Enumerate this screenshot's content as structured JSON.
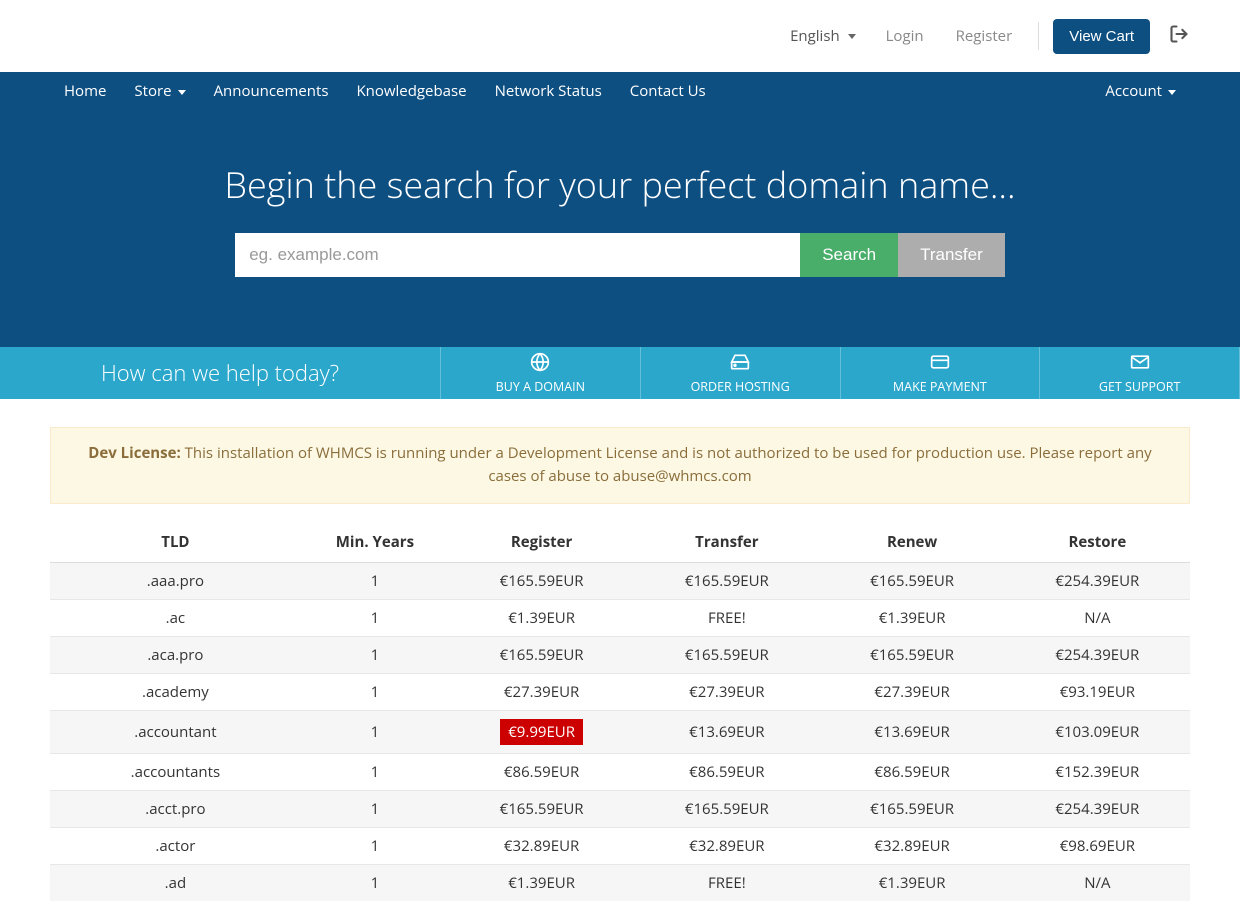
{
  "topbar": {
    "language": "English",
    "login": "Login",
    "register": "Register",
    "view_cart": "View Cart"
  },
  "nav": {
    "items": [
      "Home",
      "Store",
      "Announcements",
      "Knowledgebase",
      "Network Status",
      "Contact Us"
    ],
    "account": "Account"
  },
  "hero": {
    "title": "Begin the search for your perfect domain name...",
    "placeholder": "eg. example.com",
    "search": "Search",
    "transfer": "Transfer"
  },
  "help": {
    "text": "How can we help today?",
    "tiles": [
      {
        "label": "BUY A DOMAIN"
      },
      {
        "label": "ORDER HOSTING"
      },
      {
        "label": "MAKE PAYMENT"
      },
      {
        "label": "GET SUPPORT"
      }
    ]
  },
  "alert": {
    "strong": "Dev License:",
    "text": "This installation of WHMCS is running under a Development License and is not authorized to be used for production use. Please report any cases of abuse to abuse@whmcs.com"
  },
  "table": {
    "headers": [
      "TLD",
      "Min. Years",
      "Register",
      "Transfer",
      "Renew",
      "Restore"
    ],
    "rows": [
      {
        "tld": ".aaa.pro",
        "min": "1",
        "register": "€165.59EUR",
        "transfer": "€165.59EUR",
        "renew": "€165.59EUR",
        "restore": "€254.39EUR",
        "sale": false
      },
      {
        "tld": ".ac",
        "min": "1",
        "register": "€1.39EUR",
        "transfer": "FREE!",
        "renew": "€1.39EUR",
        "restore": "N/A",
        "sale": false
      },
      {
        "tld": ".aca.pro",
        "min": "1",
        "register": "€165.59EUR",
        "transfer": "€165.59EUR",
        "renew": "€165.59EUR",
        "restore": "€254.39EUR",
        "sale": false
      },
      {
        "tld": ".academy",
        "min": "1",
        "register": "€27.39EUR",
        "transfer": "€27.39EUR",
        "renew": "€27.39EUR",
        "restore": "€93.19EUR",
        "sale": false
      },
      {
        "tld": ".accountant",
        "min": "1",
        "register": "€9.99EUR",
        "transfer": "€13.69EUR",
        "renew": "€13.69EUR",
        "restore": "€103.09EUR",
        "sale": true
      },
      {
        "tld": ".accountants",
        "min": "1",
        "register": "€86.59EUR",
        "transfer": "€86.59EUR",
        "renew": "€86.59EUR",
        "restore": "€152.39EUR",
        "sale": false
      },
      {
        "tld": ".acct.pro",
        "min": "1",
        "register": "€165.59EUR",
        "transfer": "€165.59EUR",
        "renew": "€165.59EUR",
        "restore": "€254.39EUR",
        "sale": false
      },
      {
        "tld": ".actor",
        "min": "1",
        "register": "€32.89EUR",
        "transfer": "€32.89EUR",
        "renew": "€32.89EUR",
        "restore": "€98.69EUR",
        "sale": false
      },
      {
        "tld": ".ad",
        "min": "1",
        "register": "€1.39EUR",
        "transfer": "FREE!",
        "renew": "€1.39EUR",
        "restore": "N/A",
        "sale": false
      }
    ]
  }
}
